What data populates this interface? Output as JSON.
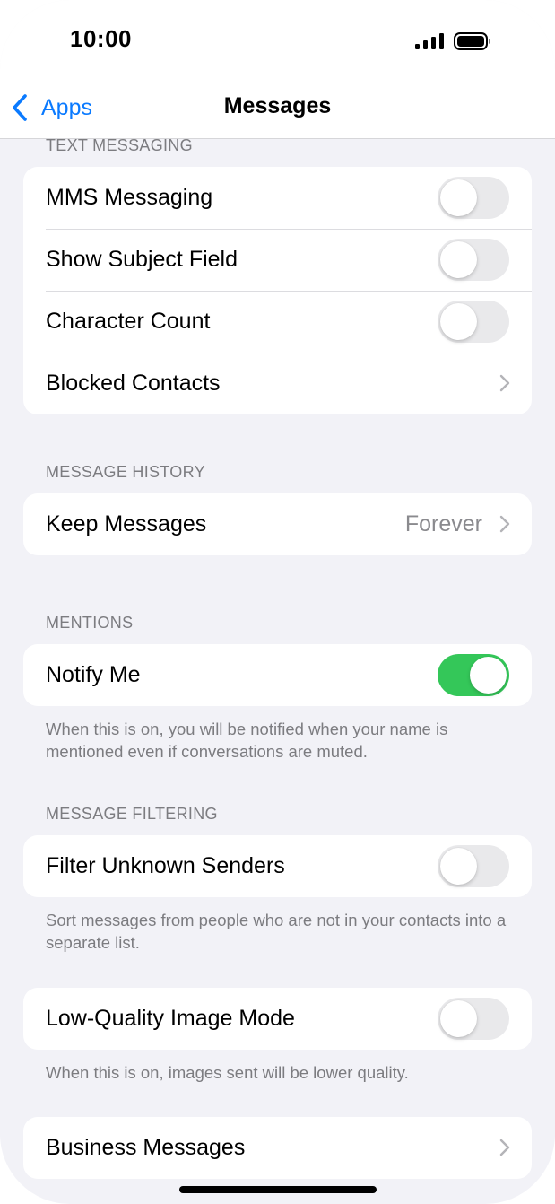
{
  "status_bar": {
    "time": "10:00",
    "signal_icon": "cellular-signal-icon",
    "battery_icon": "battery-full-icon"
  },
  "nav": {
    "back_label": "Apps",
    "back_icon": "chevron-left-icon",
    "title": "Messages",
    "accent_color": "#0a7aff"
  },
  "sections": {
    "text_messaging": {
      "header": "TEXT MESSAGING",
      "rows": [
        {
          "label": "MMS Messaging",
          "control": "toggle",
          "on": false
        },
        {
          "label": "Show Subject Field",
          "control": "toggle",
          "on": false
        },
        {
          "label": "Character Count",
          "control": "toggle",
          "on": false
        },
        {
          "label": "Blocked Contacts",
          "control": "chevron"
        }
      ]
    },
    "message_history": {
      "header": "MESSAGE HISTORY",
      "rows": [
        {
          "label": "Keep Messages",
          "value": "Forever",
          "control": "chevron"
        }
      ]
    },
    "mentions": {
      "header": "MENTIONS",
      "rows": [
        {
          "label": "Notify Me",
          "control": "toggle",
          "on": true
        }
      ],
      "footer": "When this is on, you will be notified when your name is mentioned even if conversations are muted."
    },
    "message_filtering": {
      "header": "MESSAGE FILTERING",
      "rows": [
        {
          "label": "Filter Unknown Senders",
          "control": "toggle",
          "on": false
        }
      ],
      "footer": "Sort messages from people who are not in your contacts into a separate list."
    },
    "low_quality": {
      "rows": [
        {
          "label": "Low-Quality Image Mode",
          "control": "toggle",
          "on": false
        }
      ],
      "footer": "When this is on, images sent will be lower quality."
    },
    "business": {
      "rows": [
        {
          "label": "Business Messages",
          "control": "chevron"
        }
      ]
    }
  },
  "colors": {
    "toggle_on": "#34c759",
    "toggle_off": "#e9e9eb",
    "background": "#f2f2f7"
  }
}
